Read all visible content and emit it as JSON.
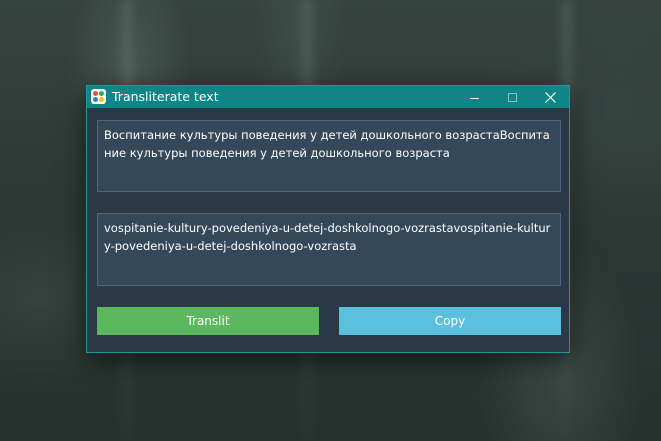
{
  "window": {
    "title": "Transliterate text",
    "controls": {
      "minimize": "minimize",
      "maximize": "maximize",
      "close": "✕"
    }
  },
  "source_text": "Воспитание культуры поведения у детей дошкольного возрастаВоспитание культуры поведения у детей дошкольного возраста",
  "result_text": "vospitanie-kultury-povedeniya-u-detej-doshkolnogo-vozrastavospitanie-kultury-povedeniya-u-detej-doshkolnogo-vozrasta",
  "buttons": {
    "translit": "Translit",
    "copy": "Copy"
  },
  "colors": {
    "titlebar": "#0f8685",
    "window_bg": "#2b3845",
    "translit_button": "#5cb85c",
    "copy_button": "#5bc0de"
  },
  "icons": {
    "app": "app-logo-icon",
    "minimize": "minimize-icon",
    "maximize": "maximize-icon",
    "close": "close-icon"
  }
}
